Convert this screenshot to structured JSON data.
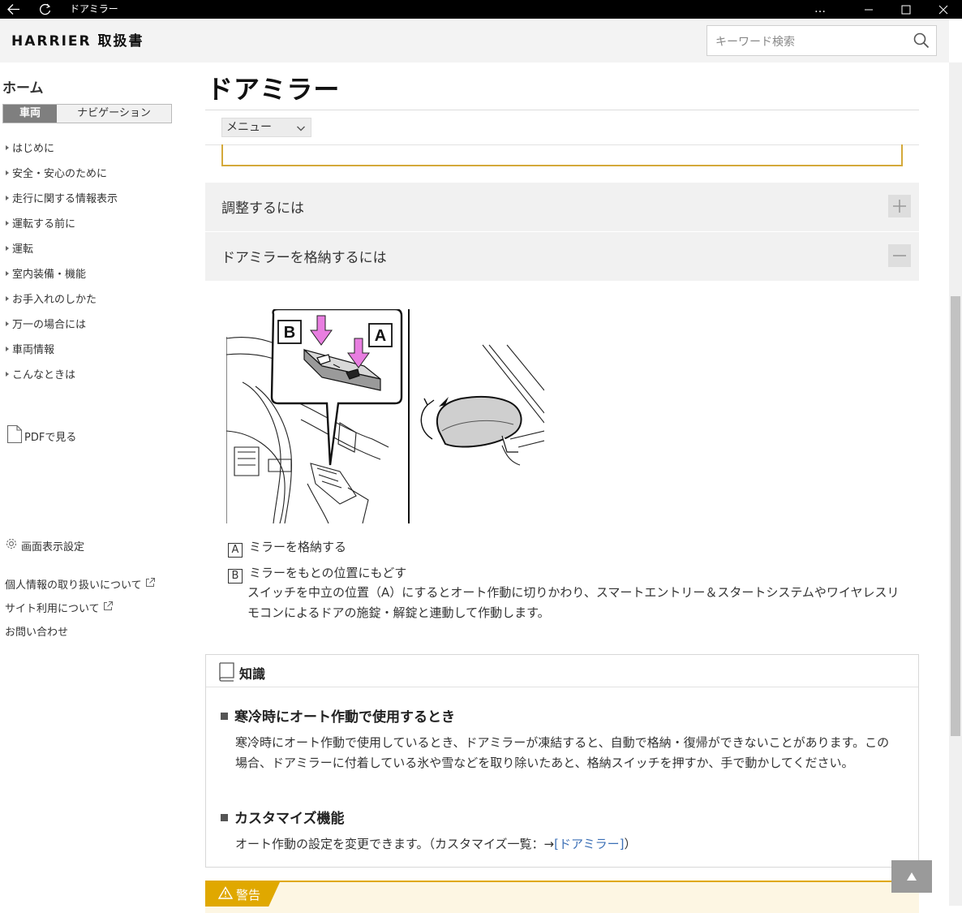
{
  "window": {
    "title": "ドアミラー",
    "more": "…"
  },
  "header": {
    "brand": "HARRIER 取扱書",
    "search_placeholder": "キーワード検索"
  },
  "sidebar": {
    "home": "ホーム",
    "tabs": [
      "車両",
      "ナビゲーション"
    ],
    "nav_items": [
      "はじめに",
      "安全・安心のために",
      "走行に関する情報表示",
      "運転する前に",
      "運転",
      "室内装備・機能",
      "お手入れのしかた",
      "万一の場合には",
      "車両情報",
      "こんなときは"
    ],
    "pdf": "PDFで見る",
    "display_settings": "画面表示設定",
    "privacy": "個人情報の取り扱いについて",
    "terms": "サイト利用について",
    "contact": "お問い合わせ"
  },
  "main": {
    "title": "ドアミラー",
    "menu_select": "メニュー",
    "accordion": [
      {
        "label": "調整するには",
        "state": "collapsed"
      },
      {
        "label": "ドアミラーを格納するには",
        "state": "expanded"
      }
    ],
    "figure_labels": {
      "a": "A",
      "b": "B"
    },
    "legend": [
      {
        "key": "A",
        "text": "ミラーを格納する"
      },
      {
        "key": "B",
        "text": "ミラーをもとの位置にもどす"
      }
    ],
    "legend_b_desc": "スイッチを中立の位置（A）にするとオート作動に切りかわり、スマートエントリー＆スタートシステムやワイヤレスリモコンによるドアの施錠・解錠と連動して作動します。",
    "knowledge": {
      "title": "知識",
      "sections": [
        {
          "heading": "寒冷時にオート作動で使用するとき",
          "text": "寒冷時にオート作動で使用しているとき、ドアミラーが凍結すると、自動で格納・復帰ができないことがあります。この場合、ドアミラーに付着している氷や雪などを取り除いたあと、格納スイッチを押すか、手で動かしてください。"
        },
        {
          "heading": "カスタマイズ機能",
          "text_prefix": "オート作動の設定を変更できます。（カスタマイズ一覧：→",
          "link": "[ドアミラー]",
          "text_suffix": "）"
        }
      ]
    },
    "warning_label": "警告"
  },
  "colors": {
    "accent_yellow": "#e0a800",
    "link": "#3b6fb6",
    "tab_active": "#7f7f7f"
  }
}
